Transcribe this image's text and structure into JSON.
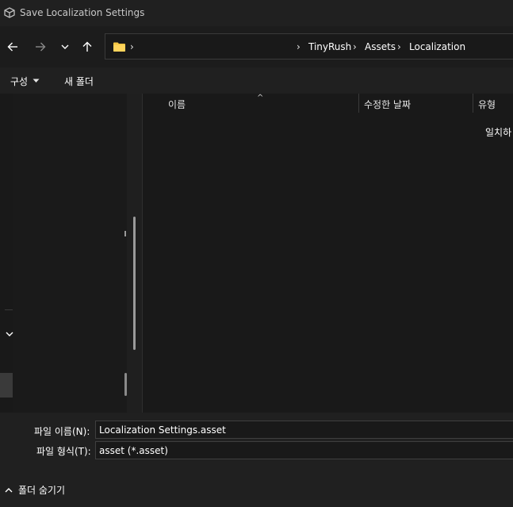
{
  "window": {
    "title": "Save Localization Settings",
    "icon": "unity-cube-icon"
  },
  "nav": {
    "back_icon": "arrow-left-icon",
    "forward_icon": "arrow-right-icon",
    "recent_icon": "chevron-down-icon",
    "up_icon": "arrow-up-icon"
  },
  "address": {
    "folder_icon": "folder-icon",
    "root_chevron": "›",
    "breadcrumbs": [
      "TinyRush",
      "Assets",
      "Localization"
    ],
    "separator": "›"
  },
  "command_bar": {
    "organize": "구성",
    "new_folder": "새 폴더"
  },
  "file_list": {
    "columns": [
      "이름",
      "수정한 날짜",
      "유형"
    ],
    "empty_message": "일치하"
  },
  "bottom": {
    "file_name_label": "파일 이름(N):",
    "file_name_value": "Localization Settings.asset",
    "file_type_label": "파일 형식(T):",
    "file_type_value": "asset (*.asset)",
    "hide_folders": "폴더 숨기기"
  },
  "colors": {
    "background": "#191919",
    "titlebar": "#202020",
    "text": "#ffffff",
    "folder": "#f5c542"
  }
}
